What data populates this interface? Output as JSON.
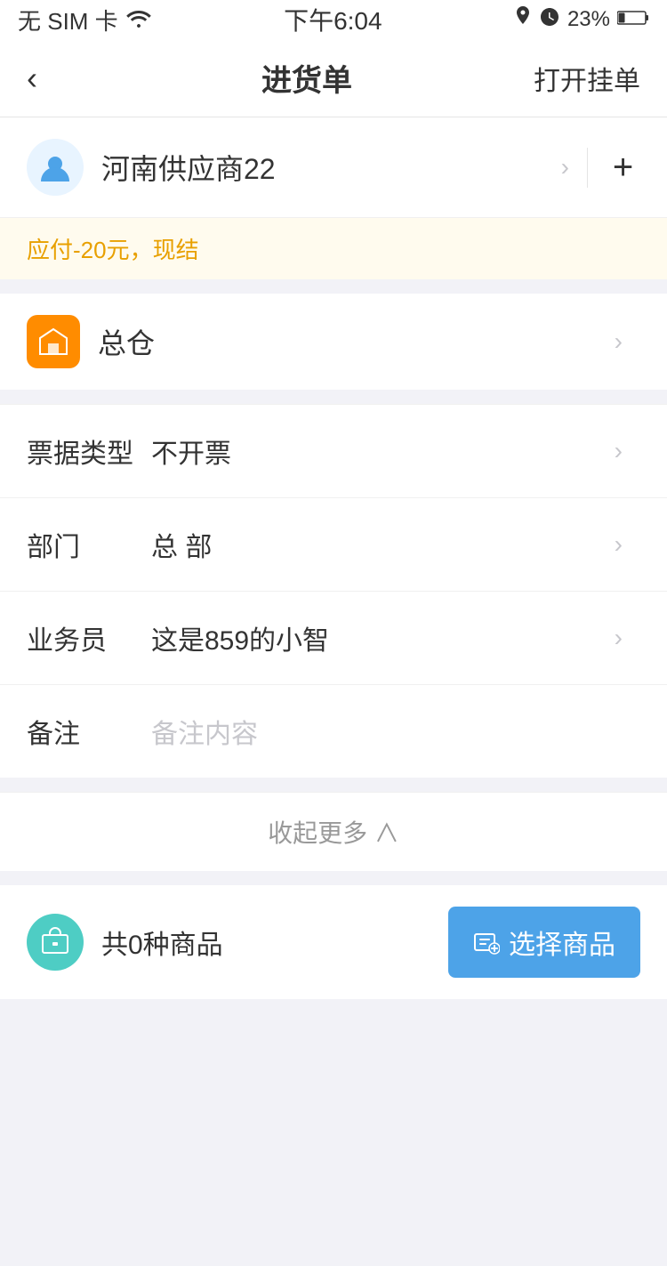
{
  "statusBar": {
    "carrier": "无 SIM 卡",
    "wifi": true,
    "time": "下午6:04",
    "location": true,
    "alarm": true,
    "battery": "23%"
  },
  "navBar": {
    "backLabel": "‹",
    "title": "进货单",
    "actionLabel": "打开挂单"
  },
  "supplier": {
    "name": "河南供应商22",
    "notice": "应付-20元，现结"
  },
  "warehouse": {
    "name": "总仓"
  },
  "form": {
    "invoiceLabel": "票据类型",
    "invoiceValue": "不开票",
    "deptLabel": "部门",
    "deptValue": "总 部",
    "salesLabel": "业务员",
    "salesValue": "这是859的小智",
    "remarkLabel": "备注",
    "remarkPlaceholder": "备注内容"
  },
  "collapseLabel": "收起更多 ∧",
  "products": {
    "count": "共0种商品",
    "selectBtnLabel": "选择商品"
  }
}
